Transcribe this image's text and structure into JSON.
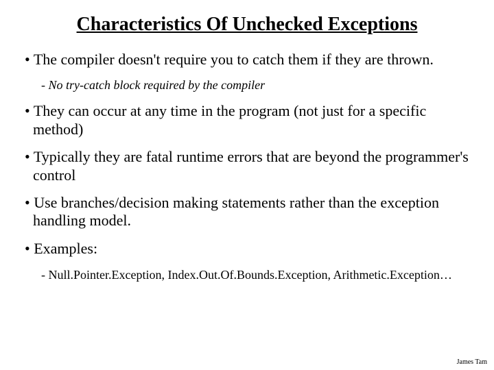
{
  "title": "Characteristics Of Unchecked Exceptions",
  "bullets": [
    {
      "text": "The compiler doesn't require you to catch them if they are thrown.",
      "sub": {
        "text": "No try-catch block required by the compiler",
        "italic": true
      }
    },
    {
      "text": "They can occur at any time in the program (not just for a specific method)"
    },
    {
      "text": "Typically they are fatal runtime errors that are beyond the programmer's control"
    },
    {
      "text": "Use branches/decision making statements rather than the exception handling model."
    },
    {
      "text": "Examples:",
      "sub": {
        "text": "Null.Pointer.Exception, Index.Out.Of.Bounds.Exception, Arithmetic.Exception…",
        "italic": false
      }
    }
  ],
  "footer": "James Tam"
}
